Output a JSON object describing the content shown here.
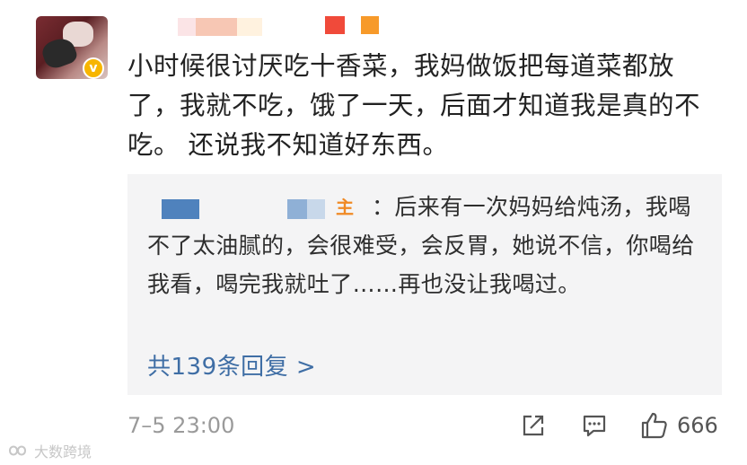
{
  "comment": {
    "text": "小时候很讨厌吃十香菜，我妈做饭把每道菜都放了，我就不吃，饿了一天，后面才知道我是真的不吃。 还说我不知道好东西。",
    "verified_badge": "v",
    "timestamp": "7–5 23:00",
    "like_count": "666"
  },
  "reply": {
    "host_badge": "主",
    "text": "：后来有一次妈妈给炖汤，我喝不了太油腻的，会很难受，会反胃，她说不信，你喝给我看，喝完我就吐了……再也没让我喝过。",
    "more_label": "共139条回复 >"
  },
  "watermark": {
    "text": "大数跨境"
  },
  "colors": {
    "link": "#3f6ea5",
    "badge": "#f7b500",
    "host": "#f08a25",
    "reply_bg": "#f4f4f5",
    "meta": "#9a9a9a"
  },
  "icons": [
    "share-icon",
    "comment-icon",
    "like-icon"
  ]
}
